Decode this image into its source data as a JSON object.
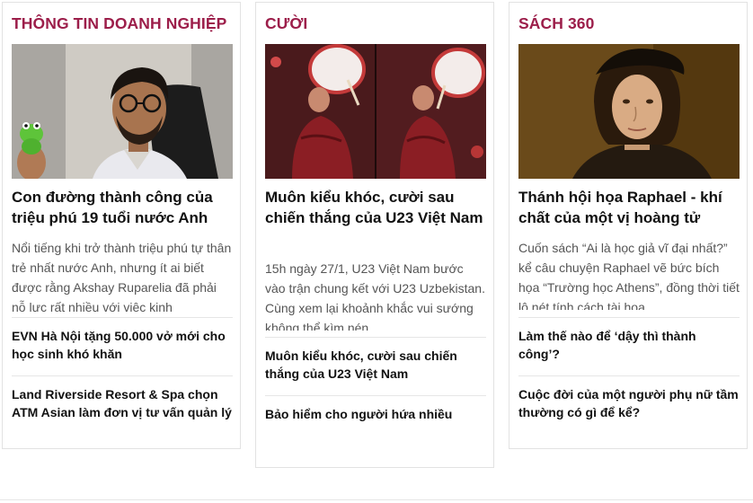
{
  "columns": [
    {
      "title": "THÔNG TIN DOANH NGHIỆP",
      "image_alt": "young-man-with-glasses-holding-frog-toy",
      "headline": "Con đường thành công của triệu phú 19 tuổi nước Anh",
      "summary": "Nổi tiếng khi trở thành triệu phú tự thân trẻ nhất nước Anh, nhưng ít ai biết được rằng Akshay Ruparelia đã phải nỗ lực rất nhiều với việc kinh",
      "related": [
        "EVN Hà Nội tặng 50.000 vở mới cho học sinh khó khăn",
        "Land Riverside Resort & Spa chọn ATM Asian làm đơn vị tư vấn quản lý"
      ]
    },
    {
      "title": "CƯỜI",
      "image_alt": "fans-celebrating-with-drums",
      "headline": "Muôn kiểu khóc, cười sau chiến thắng của U23 Việt Nam",
      "summary": "15h ngày 27/1, U23 Việt Nam bước vào trận chung kết với U23 Uzbekistan. Cùng xem lại khoảnh khắc vui sướng không thể kìm nén",
      "related": [
        "Muôn kiểu khóc, cười sau chiến thắng của U23 Việt Nam",
        "Bảo hiểm cho người hứa nhiều"
      ]
    },
    {
      "title": "SÁCH 360",
      "image_alt": "raphael-self-portrait-painting",
      "headline": "Thánh hội họa Raphael - khí chất của một vị hoàng tử",
      "summary": "Cuốn sách “Ai là học giả vĩ đại nhất?” kể câu chuyện Raphael vẽ bức bích họa “Trường học Athens”, đồng thời tiết lộ nét tính cách tài hoa",
      "related": [
        "Làm thế nào để ‘dậy thì thành công’?",
        "Cuộc đời của một người phụ nữ tầm thường có gì để kể?"
      ]
    }
  ],
  "colors": {
    "section_title": "#9c1e4a",
    "headline": "#111111",
    "summary": "#555555",
    "border": "#e2e2e2"
  }
}
